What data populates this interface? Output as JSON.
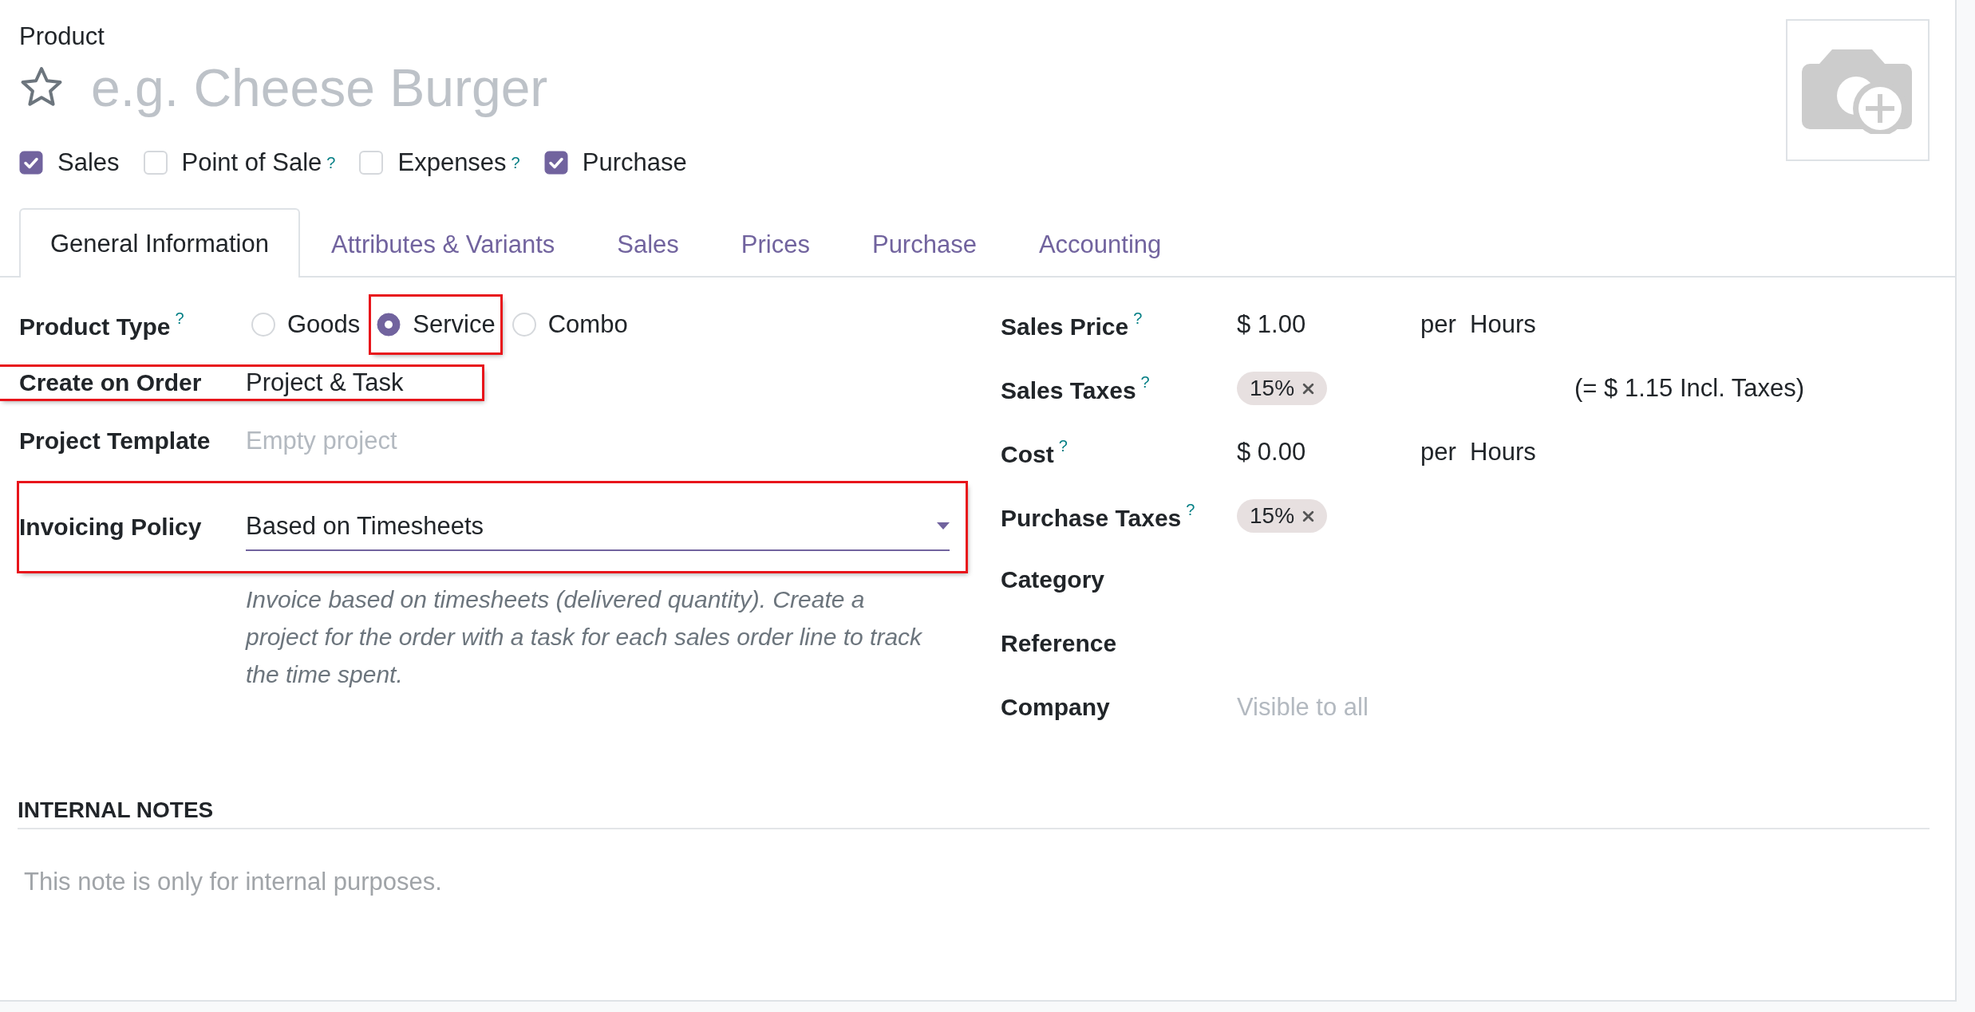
{
  "form_label": "Product",
  "name_field": {
    "placeholder": "e.g. Cheese Burger",
    "favorite": false
  },
  "flags": [
    {
      "label": "Sales",
      "checked": true
    },
    {
      "label": "Point of Sale",
      "checked": false,
      "help": "?"
    },
    {
      "label": "Expenses",
      "checked": false,
      "help": "?"
    },
    {
      "label": "Purchase",
      "checked": true
    }
  ],
  "tabs": [
    {
      "label": "General Information",
      "selected": true
    },
    {
      "label": "Attributes & Variants",
      "selected": false
    },
    {
      "label": "Sales",
      "selected": false
    },
    {
      "label": "Prices",
      "selected": false
    },
    {
      "label": "Purchase",
      "selected": false
    },
    {
      "label": "Accounting",
      "selected": false
    }
  ],
  "left_fields": [
    {
      "kind": "radio",
      "label": "Product Type",
      "help": "?",
      "highlighted": false,
      "options": [
        {
          "label": "Goods",
          "selected": false,
          "highlighted": false
        },
        {
          "label": "Service",
          "selected": true,
          "highlighted": true
        },
        {
          "label": "Combo",
          "selected": false,
          "highlighted": false
        }
      ]
    },
    {
      "kind": "text",
      "label": "Create on Order",
      "value": "Project & Task",
      "highlighted": true
    },
    {
      "kind": "text",
      "label": "Project Template",
      "placeholder": "Empty project",
      "highlighted": false
    },
    {
      "kind": "select",
      "label": "Invoicing Policy",
      "value": "Based on Timesheets",
      "highlighted": true,
      "note": "Invoice based on timesheets (delivered quantity). Create a project for the order with a task for each sales order line to track the time spent."
    }
  ],
  "right_fields": [
    {
      "kind": "money",
      "label": "Sales Price",
      "help": "?",
      "value": "$ 1.00",
      "unit_prefix": "per",
      "unit": "Hours"
    },
    {
      "kind": "tags",
      "label": "Sales Taxes",
      "help": "?",
      "tags": [
        "15%"
      ],
      "extra": "(= $ 1.15 Incl. Taxes)"
    },
    {
      "kind": "money",
      "label": "Cost",
      "help": "?",
      "value": "$ 0.00",
      "unit_prefix": "per",
      "unit": "Hours"
    },
    {
      "kind": "tags",
      "label": "Purchase Taxes",
      "help": "?",
      "tags": [
        "15%"
      ]
    },
    {
      "kind": "text",
      "label": "Category"
    },
    {
      "kind": "text",
      "label": "Reference"
    },
    {
      "kind": "text",
      "label": "Company",
      "placeholder": "Visible to all"
    }
  ],
  "notes": {
    "title": "INTERNAL NOTES",
    "placeholder": "This note is only for internal purposes."
  }
}
